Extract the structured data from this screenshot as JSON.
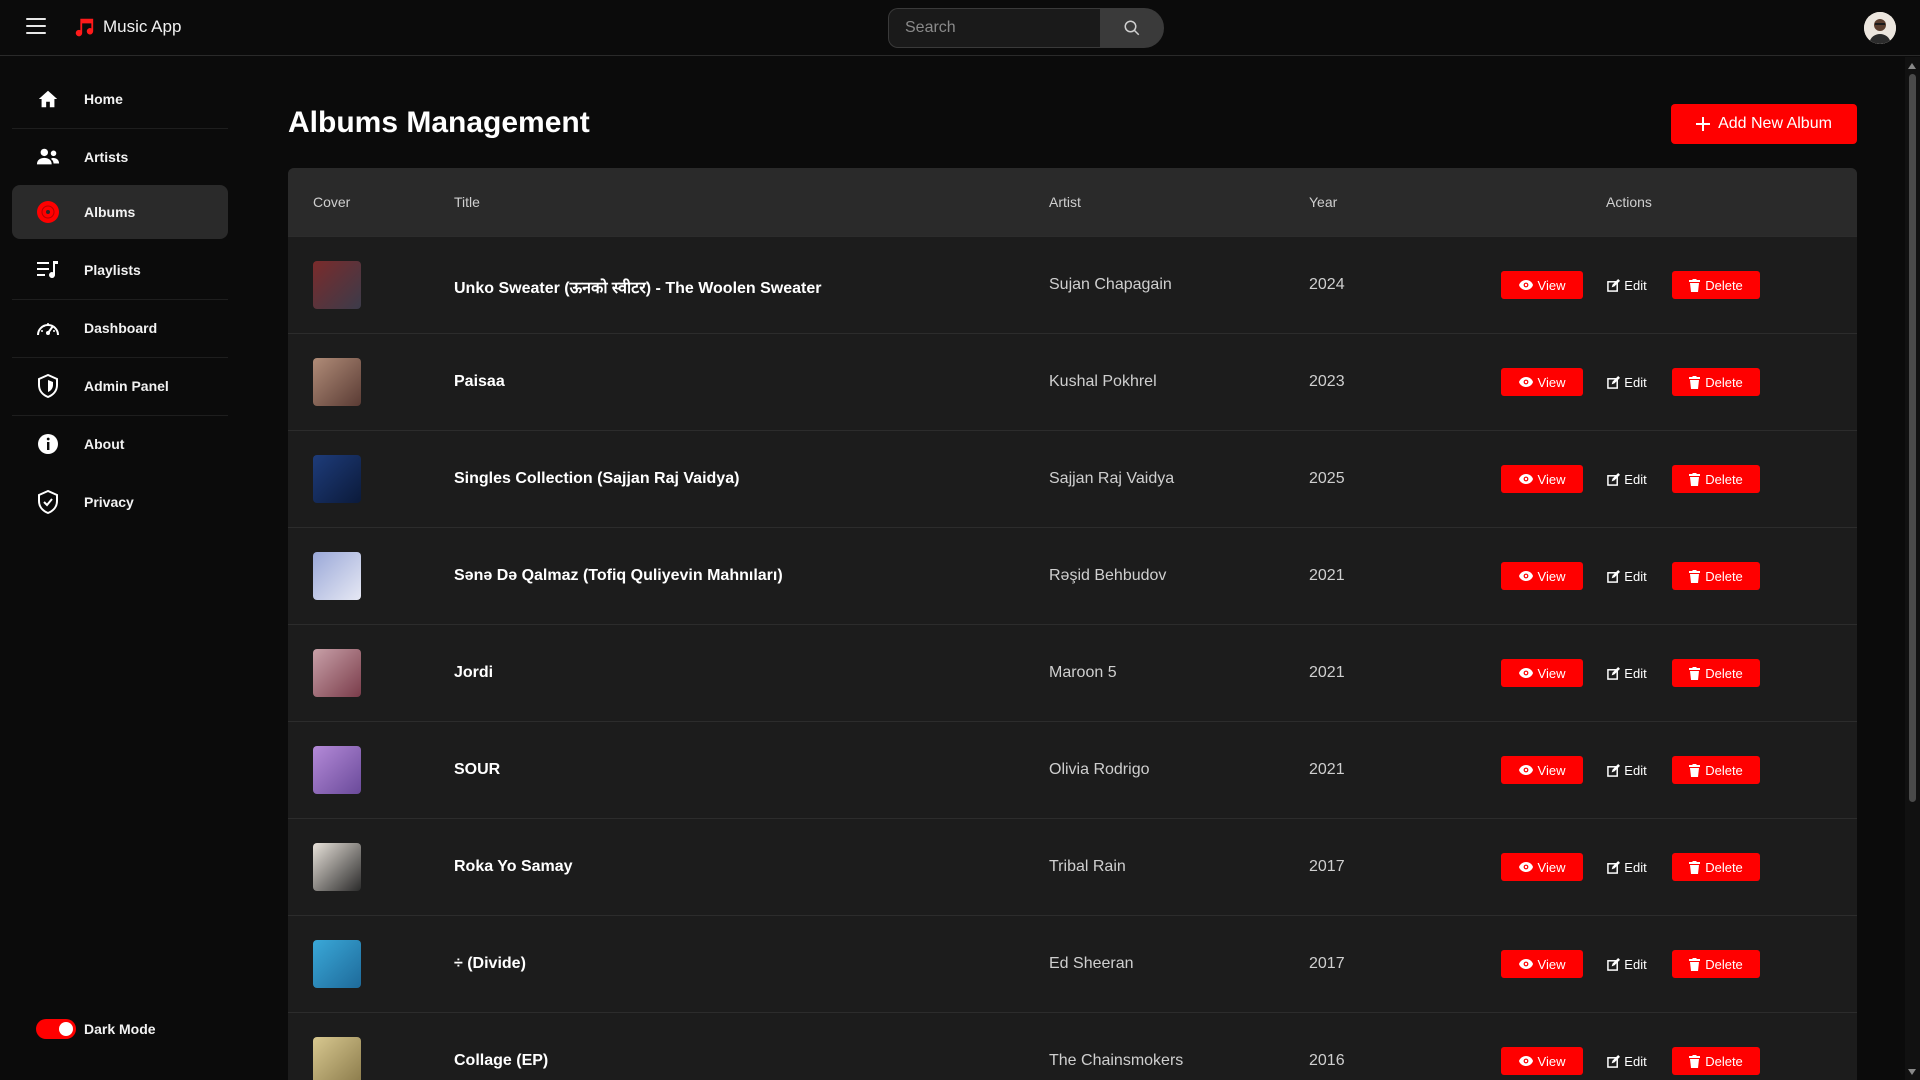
{
  "app": {
    "title": "Music App"
  },
  "search": {
    "placeholder": "Search"
  },
  "sidebar": {
    "items": [
      {
        "label": "Home",
        "icon": "home-icon"
      },
      {
        "label": "Artists",
        "icon": "users-icon"
      },
      {
        "label": "Albums",
        "icon": "album-disc-icon",
        "active": true
      },
      {
        "label": "Playlists",
        "icon": "playlist-icon"
      },
      {
        "label": "Dashboard",
        "icon": "gauge-icon"
      },
      {
        "label": "Admin Panel",
        "icon": "shield-icon"
      },
      {
        "label": "About",
        "icon": "info-icon"
      },
      {
        "label": "Privacy",
        "icon": "shield-check-icon"
      }
    ],
    "dark_mode_label": "Dark Mode",
    "dark_mode_on": true
  },
  "main": {
    "page_title": "Albums Management",
    "add_button_label": "Add New Album",
    "table": {
      "headers": {
        "cover": "Cover",
        "title": "Title",
        "artist": "Artist",
        "year": "Year",
        "actions": "Actions"
      },
      "action_labels": {
        "view": "View",
        "edit": "Edit",
        "delete": "Delete"
      },
      "rows": [
        {
          "title": "Unko Sweater (ऊनको स्वीटर) - The Woolen Sweater",
          "artist": "Sujan Chapagain",
          "year": "2024"
        },
        {
          "title": "Paisaa",
          "artist": "Kushal Pokhrel",
          "year": "2023"
        },
        {
          "title": "Singles Collection (Sajjan Raj Vaidya)",
          "artist": "Sajjan Raj Vaidya",
          "year": "2025"
        },
        {
          "title": "Sənə Də Qalmaz (Tofiq Quliyevin Mahnıları)",
          "artist": "Rəşid Behbudov",
          "year": "2021"
        },
        {
          "title": "Jordi",
          "artist": "Maroon 5",
          "year": "2021"
        },
        {
          "title": "SOUR",
          "artist": "Olivia Rodrigo",
          "year": "2021"
        },
        {
          "title": "Roka Yo Samay",
          "artist": "Tribal Rain",
          "year": "2017"
        },
        {
          "title": "÷ (Divide)",
          "artist": "Ed Sheeran",
          "year": "2017"
        },
        {
          "title": "Collage (EP)",
          "artist": "The Chainsmokers",
          "year": "2016"
        }
      ]
    }
  },
  "colors": {
    "accent": "#ff0000",
    "background": "#0b0b0b",
    "panel": "#1c1c1c",
    "header_row": "#2a2a2a"
  }
}
